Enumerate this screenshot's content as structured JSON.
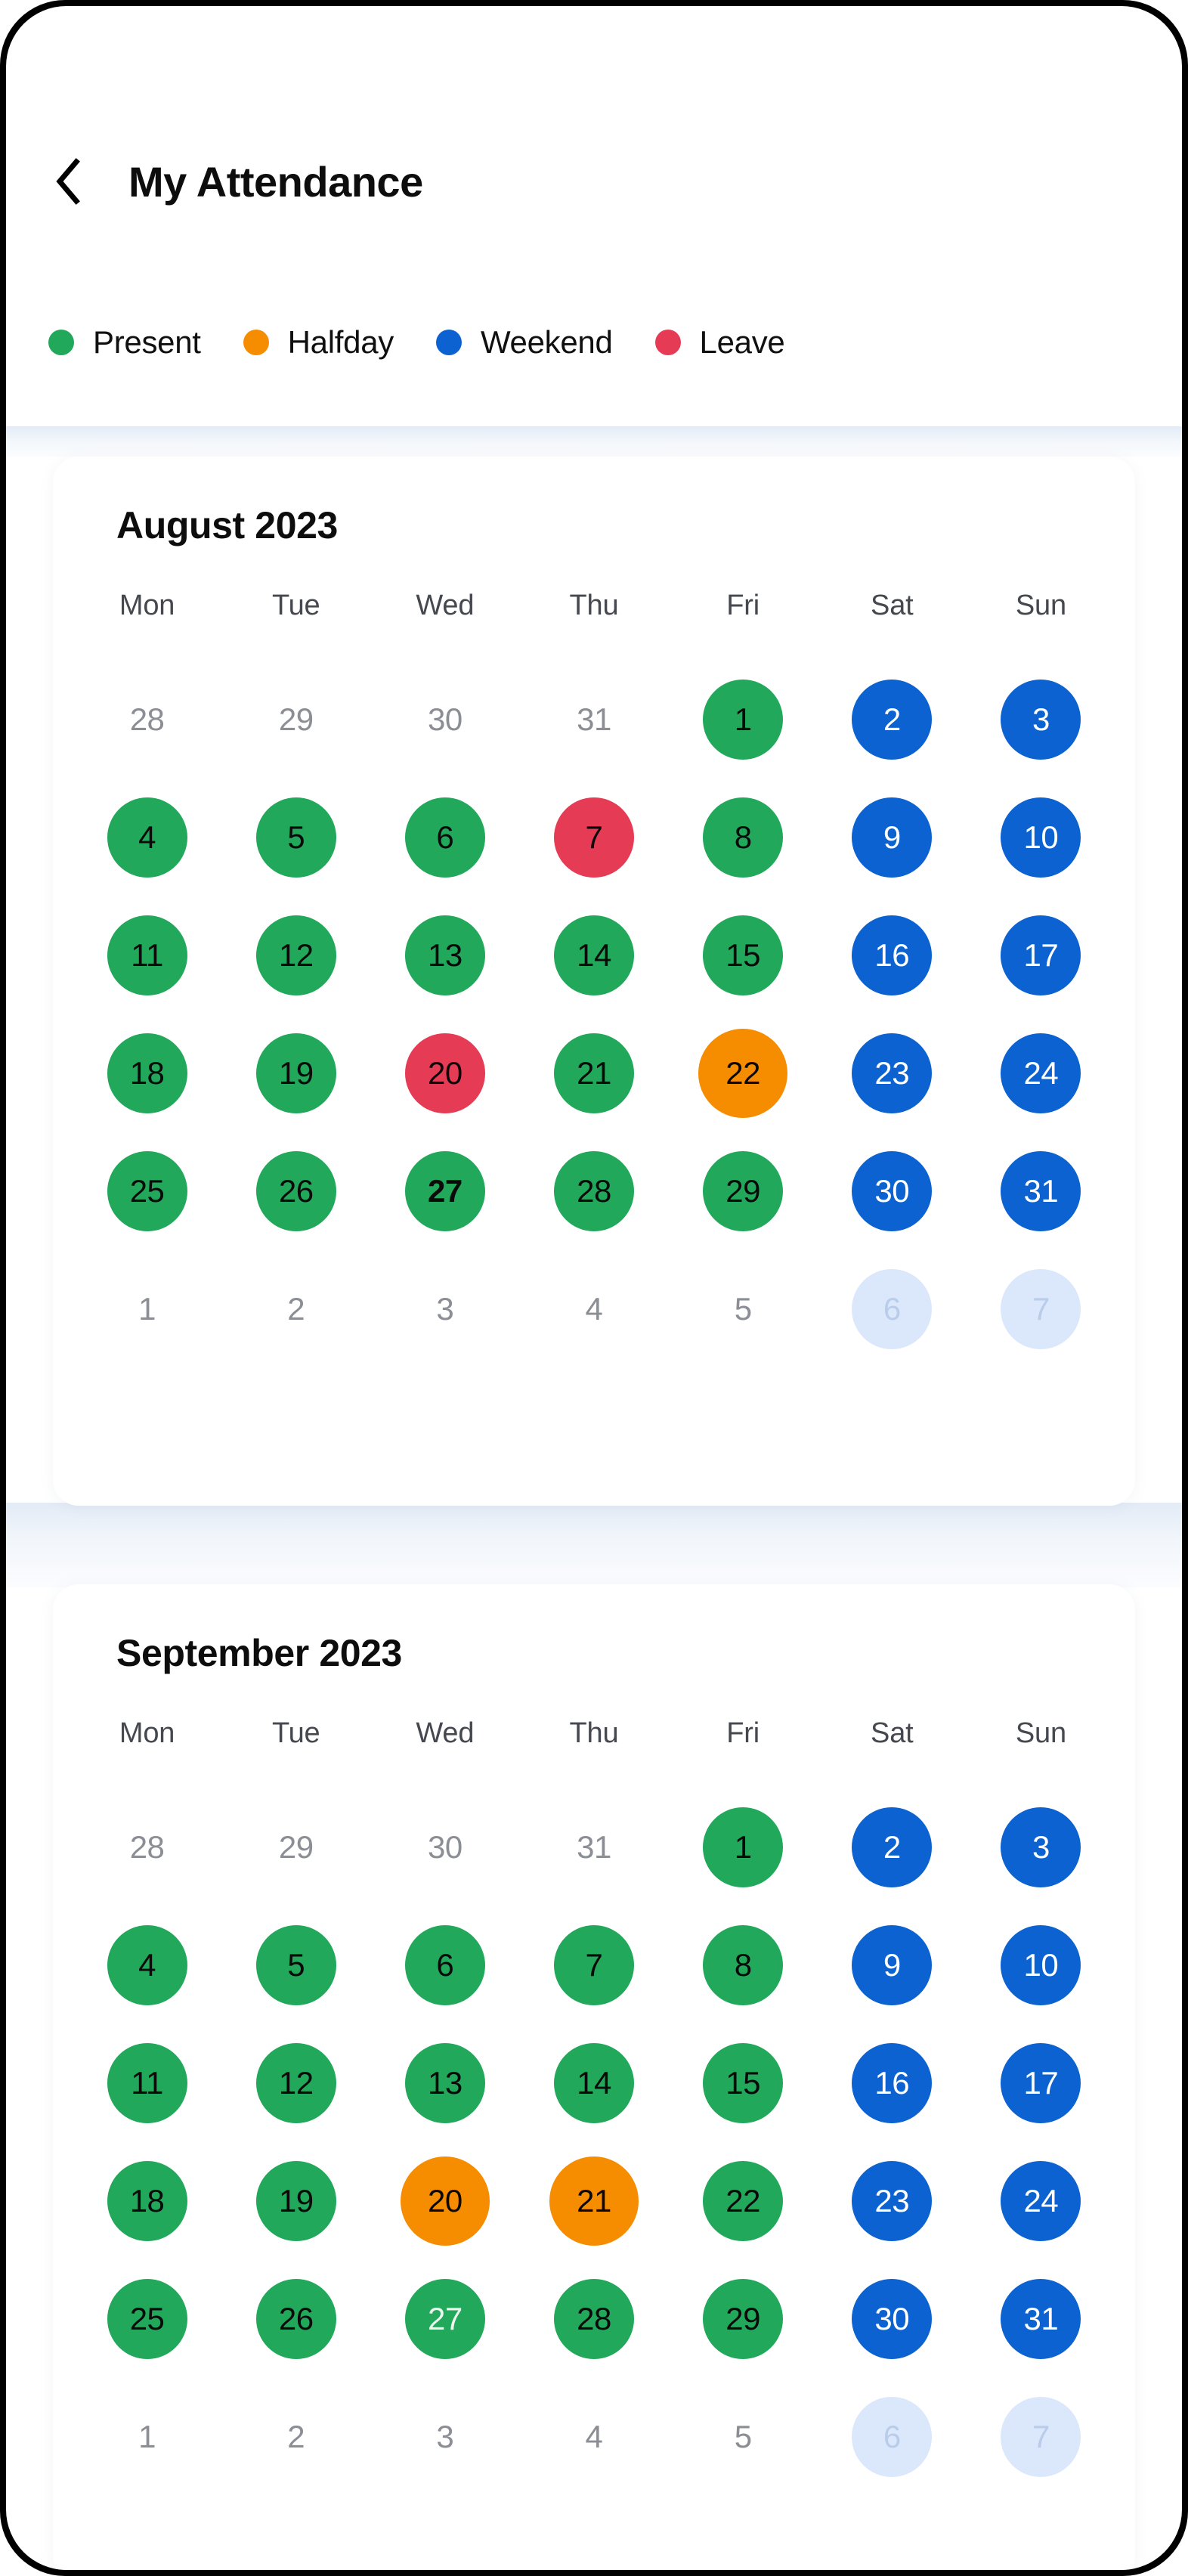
{
  "header": {
    "back_icon": "chevron-left-icon",
    "title": "My Attendance"
  },
  "legend": {
    "items": [
      {
        "label": "Present",
        "color": "#22a85a"
      },
      {
        "label": "Halfday",
        "color": "#f68c00"
      },
      {
        "label": "Weekend",
        "color": "#0b62d0"
      },
      {
        "label": "Leave",
        "color": "#e63b55"
      }
    ]
  },
  "weekdays": [
    "Mon",
    "Tue",
    "Wed",
    "Thu",
    "Fri",
    "Sat",
    "Sun"
  ],
  "months": [
    {
      "title": "August 2023",
      "weeks": [
        [
          {
            "day": "28",
            "state": "outside"
          },
          {
            "day": "29",
            "state": "outside"
          },
          {
            "day": "30",
            "state": "outside"
          },
          {
            "day": "31",
            "state": "outside"
          },
          {
            "day": "1",
            "state": "present"
          },
          {
            "day": "2",
            "state": "weekend"
          },
          {
            "day": "3",
            "state": "weekend"
          }
        ],
        [
          {
            "day": "4",
            "state": "present"
          },
          {
            "day": "5",
            "state": "present"
          },
          {
            "day": "6",
            "state": "present"
          },
          {
            "day": "7",
            "state": "leave"
          },
          {
            "day": "8",
            "state": "present"
          },
          {
            "day": "9",
            "state": "weekend"
          },
          {
            "day": "10",
            "state": "weekend"
          }
        ],
        [
          {
            "day": "11",
            "state": "present"
          },
          {
            "day": "12",
            "state": "present"
          },
          {
            "day": "13",
            "state": "present"
          },
          {
            "day": "14",
            "state": "present"
          },
          {
            "day": "15",
            "state": "present"
          },
          {
            "day": "16",
            "state": "weekend"
          },
          {
            "day": "17",
            "state": "weekend"
          }
        ],
        [
          {
            "day": "18",
            "state": "present"
          },
          {
            "day": "19",
            "state": "present"
          },
          {
            "day": "20",
            "state": "leave"
          },
          {
            "day": "21",
            "state": "present"
          },
          {
            "day": "22",
            "state": "halfday"
          },
          {
            "day": "23",
            "state": "weekend"
          },
          {
            "day": "24",
            "state": "weekend"
          }
        ],
        [
          {
            "day": "25",
            "state": "present"
          },
          {
            "day": "26",
            "state": "present"
          },
          {
            "day": "27",
            "state": "present",
            "emphasis": "bold"
          },
          {
            "day": "28",
            "state": "present"
          },
          {
            "day": "29",
            "state": "present"
          },
          {
            "day": "30",
            "state": "weekend"
          },
          {
            "day": "31",
            "state": "weekend"
          }
        ],
        [
          {
            "day": "1",
            "state": "outside"
          },
          {
            "day": "2",
            "state": "outside"
          },
          {
            "day": "3",
            "state": "outside"
          },
          {
            "day": "4",
            "state": "outside"
          },
          {
            "day": "5",
            "state": "outside"
          },
          {
            "day": "6",
            "state": "outside-weekend"
          },
          {
            "day": "7",
            "state": "outside-weekend"
          }
        ]
      ]
    },
    {
      "title": "September 2023",
      "weeks": [
        [
          {
            "day": "28",
            "state": "outside"
          },
          {
            "day": "29",
            "state": "outside"
          },
          {
            "day": "30",
            "state": "outside"
          },
          {
            "day": "31",
            "state": "outside"
          },
          {
            "day": "1",
            "state": "present"
          },
          {
            "day": "2",
            "state": "weekend"
          },
          {
            "day": "3",
            "state": "weekend"
          }
        ],
        [
          {
            "day": "4",
            "state": "present"
          },
          {
            "day": "5",
            "state": "present"
          },
          {
            "day": "6",
            "state": "present"
          },
          {
            "day": "7",
            "state": "present"
          },
          {
            "day": "8",
            "state": "present"
          },
          {
            "day": "9",
            "state": "weekend"
          },
          {
            "day": "10",
            "state": "weekend"
          }
        ],
        [
          {
            "day": "11",
            "state": "present"
          },
          {
            "day": "12",
            "state": "present"
          },
          {
            "day": "13",
            "state": "present"
          },
          {
            "day": "14",
            "state": "present"
          },
          {
            "day": "15",
            "state": "present"
          },
          {
            "day": "16",
            "state": "weekend"
          },
          {
            "day": "17",
            "state": "weekend"
          }
        ],
        [
          {
            "day": "18",
            "state": "present"
          },
          {
            "day": "19",
            "state": "present"
          },
          {
            "day": "20",
            "state": "halfday"
          },
          {
            "day": "21",
            "state": "halfday"
          },
          {
            "day": "22",
            "state": "present"
          },
          {
            "day": "23",
            "state": "weekend"
          },
          {
            "day": "24",
            "state": "weekend"
          }
        ],
        [
          {
            "day": "25",
            "state": "present"
          },
          {
            "day": "26",
            "state": "present"
          },
          {
            "day": "27",
            "state": "present",
            "emphasis": "lighttext"
          },
          {
            "day": "28",
            "state": "present"
          },
          {
            "day": "29",
            "state": "present"
          },
          {
            "day": "30",
            "state": "weekend"
          },
          {
            "day": "31",
            "state": "weekend"
          }
        ],
        [
          {
            "day": "1",
            "state": "outside"
          },
          {
            "day": "2",
            "state": "outside"
          },
          {
            "day": "3",
            "state": "outside"
          },
          {
            "day": "4",
            "state": "outside"
          },
          {
            "day": "5",
            "state": "outside"
          },
          {
            "day": "6",
            "state": "outside-weekend"
          },
          {
            "day": "7",
            "state": "outside-weekend"
          }
        ]
      ]
    }
  ]
}
